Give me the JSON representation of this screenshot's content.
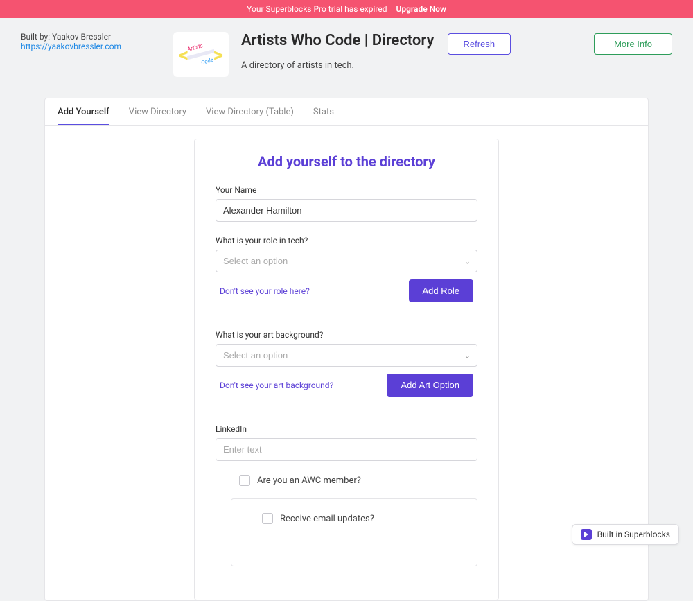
{
  "banner": {
    "text": "Your Superblocks Pro trial has expired",
    "upgrade": "Upgrade Now"
  },
  "built_by": {
    "label": "Built by: Yaakov Bressler",
    "url_text": "https://yaakovbressler.com"
  },
  "header": {
    "title": "Artists Who Code | Directory",
    "subtitle": "A directory of artists in tech.",
    "refresh": "Refresh",
    "more_info": "More Info"
  },
  "tabs": [
    {
      "label": "Add Yourself",
      "active": true
    },
    {
      "label": "View Directory",
      "active": false
    },
    {
      "label": "View Directory (Table)",
      "active": false
    },
    {
      "label": "Stats",
      "active": false
    }
  ],
  "form": {
    "title": "Add yourself to the directory",
    "name_label": "Your Name",
    "name_value": "Alexander Hamilton",
    "role_label": "What is your role in tech?",
    "role_placeholder": "Select an option",
    "role_missing_link": "Don't see your role here?",
    "add_role_btn": "Add Role",
    "art_label": "What is your art background?",
    "art_placeholder": "Select an option",
    "art_missing_link": "Don't see your art background?",
    "add_art_btn": "Add Art Option",
    "linkedin_label": "LinkedIn",
    "linkedin_placeholder": "Enter text",
    "awc_member_label": "Are you an AWC member?",
    "email_updates_label": "Receive email updates?"
  },
  "badge": {
    "text": "Built in Superblocks"
  }
}
